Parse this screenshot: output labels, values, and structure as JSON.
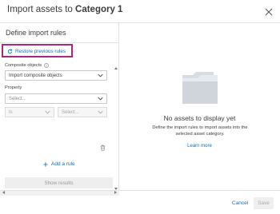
{
  "dialog": {
    "title_prefix": "Import assets to ",
    "title_category": "Category 1"
  },
  "left_panel": {
    "title": "Define import rules",
    "restore_label": "Restore previous rules",
    "composite_label": "Composite objects",
    "composite_value": "Import composite objects",
    "property_label": "Property",
    "property_placeholder": "Select...",
    "operator_value": "Is",
    "value_placeholder": "Select...",
    "add_rule_label": "Add a rule",
    "show_results_label": "Show results"
  },
  "empty_state": {
    "title": "No assets to display yet",
    "description": "Define the import rules to import assets into the selected asset category.",
    "learn_more": "Learn more"
  },
  "footer": {
    "cancel_label": "Cancel",
    "save_label": "Save"
  },
  "colors": {
    "link": "#0f6fba",
    "highlight_border": "#a8287f",
    "folder": "#d9dce2"
  },
  "icons": [
    "close-icon",
    "restore-icon",
    "info-icon",
    "chevron-down-icon",
    "trash-icon",
    "plus-icon",
    "folder-icon"
  ]
}
